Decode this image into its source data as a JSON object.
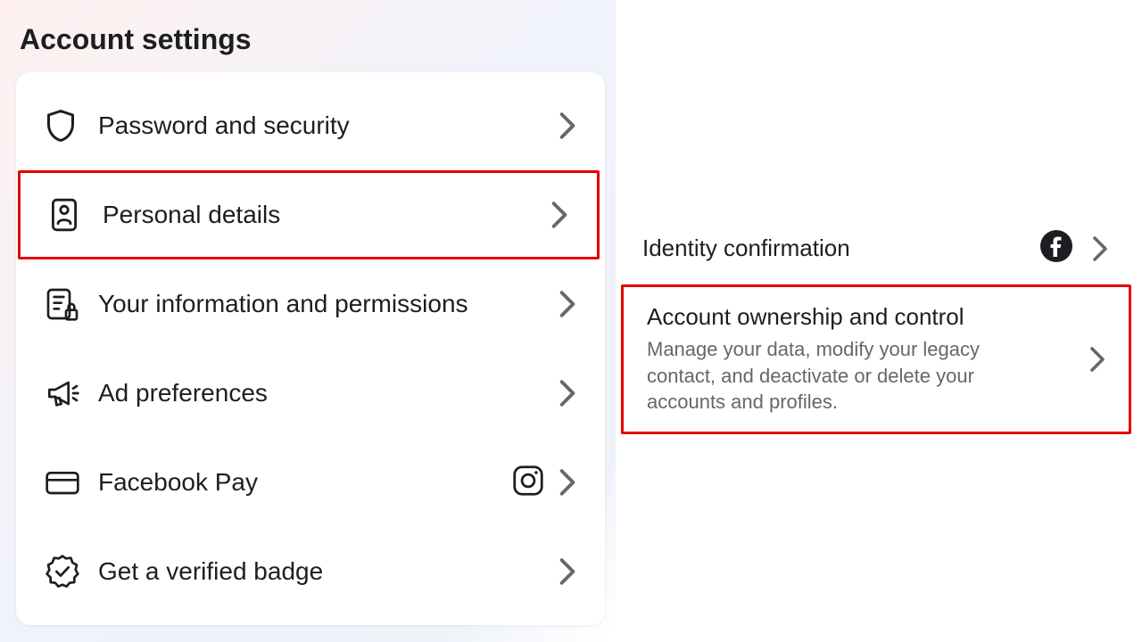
{
  "header": {
    "title": "Account settings"
  },
  "left_menu": {
    "items": [
      {
        "label": "Password and security"
      },
      {
        "label": "Personal details"
      },
      {
        "label": "Your information and permissions"
      },
      {
        "label": "Ad preferences"
      },
      {
        "label": "Facebook Pay"
      },
      {
        "label": "Get a verified badge"
      }
    ]
  },
  "right_menu": {
    "identity": {
      "title": "Identity confirmation"
    },
    "ownership": {
      "title": "Account ownership and control",
      "subtitle": "Manage your data, modify your legacy contact, and deactivate or delete your accounts and profiles."
    }
  }
}
